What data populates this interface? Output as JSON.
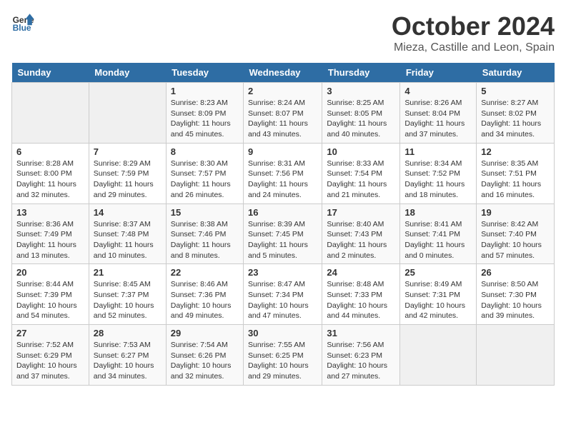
{
  "header": {
    "logo_line1": "General",
    "logo_line2": "Blue",
    "month": "October 2024",
    "location": "Mieza, Castille and Leon, Spain"
  },
  "weekdays": [
    "Sunday",
    "Monday",
    "Tuesday",
    "Wednesday",
    "Thursday",
    "Friday",
    "Saturday"
  ],
  "weeks": [
    [
      {
        "day": "",
        "info": ""
      },
      {
        "day": "",
        "info": ""
      },
      {
        "day": "1",
        "info": "Sunrise: 8:23 AM\nSunset: 8:09 PM\nDaylight: 11 hours and 45 minutes."
      },
      {
        "day": "2",
        "info": "Sunrise: 8:24 AM\nSunset: 8:07 PM\nDaylight: 11 hours and 43 minutes."
      },
      {
        "day": "3",
        "info": "Sunrise: 8:25 AM\nSunset: 8:05 PM\nDaylight: 11 hours and 40 minutes."
      },
      {
        "day": "4",
        "info": "Sunrise: 8:26 AM\nSunset: 8:04 PM\nDaylight: 11 hours and 37 minutes."
      },
      {
        "day": "5",
        "info": "Sunrise: 8:27 AM\nSunset: 8:02 PM\nDaylight: 11 hours and 34 minutes."
      }
    ],
    [
      {
        "day": "6",
        "info": "Sunrise: 8:28 AM\nSunset: 8:00 PM\nDaylight: 11 hours and 32 minutes."
      },
      {
        "day": "7",
        "info": "Sunrise: 8:29 AM\nSunset: 7:59 PM\nDaylight: 11 hours and 29 minutes."
      },
      {
        "day": "8",
        "info": "Sunrise: 8:30 AM\nSunset: 7:57 PM\nDaylight: 11 hours and 26 minutes."
      },
      {
        "day": "9",
        "info": "Sunrise: 8:31 AM\nSunset: 7:56 PM\nDaylight: 11 hours and 24 minutes."
      },
      {
        "day": "10",
        "info": "Sunrise: 8:33 AM\nSunset: 7:54 PM\nDaylight: 11 hours and 21 minutes."
      },
      {
        "day": "11",
        "info": "Sunrise: 8:34 AM\nSunset: 7:52 PM\nDaylight: 11 hours and 18 minutes."
      },
      {
        "day": "12",
        "info": "Sunrise: 8:35 AM\nSunset: 7:51 PM\nDaylight: 11 hours and 16 minutes."
      }
    ],
    [
      {
        "day": "13",
        "info": "Sunrise: 8:36 AM\nSunset: 7:49 PM\nDaylight: 11 hours and 13 minutes."
      },
      {
        "day": "14",
        "info": "Sunrise: 8:37 AM\nSunset: 7:48 PM\nDaylight: 11 hours and 10 minutes."
      },
      {
        "day": "15",
        "info": "Sunrise: 8:38 AM\nSunset: 7:46 PM\nDaylight: 11 hours and 8 minutes."
      },
      {
        "day": "16",
        "info": "Sunrise: 8:39 AM\nSunset: 7:45 PM\nDaylight: 11 hours and 5 minutes."
      },
      {
        "day": "17",
        "info": "Sunrise: 8:40 AM\nSunset: 7:43 PM\nDaylight: 11 hours and 2 minutes."
      },
      {
        "day": "18",
        "info": "Sunrise: 8:41 AM\nSunset: 7:41 PM\nDaylight: 11 hours and 0 minutes."
      },
      {
        "day": "19",
        "info": "Sunrise: 8:42 AM\nSunset: 7:40 PM\nDaylight: 10 hours and 57 minutes."
      }
    ],
    [
      {
        "day": "20",
        "info": "Sunrise: 8:44 AM\nSunset: 7:39 PM\nDaylight: 10 hours and 54 minutes."
      },
      {
        "day": "21",
        "info": "Sunrise: 8:45 AM\nSunset: 7:37 PM\nDaylight: 10 hours and 52 minutes."
      },
      {
        "day": "22",
        "info": "Sunrise: 8:46 AM\nSunset: 7:36 PM\nDaylight: 10 hours and 49 minutes."
      },
      {
        "day": "23",
        "info": "Sunrise: 8:47 AM\nSunset: 7:34 PM\nDaylight: 10 hours and 47 minutes."
      },
      {
        "day": "24",
        "info": "Sunrise: 8:48 AM\nSunset: 7:33 PM\nDaylight: 10 hours and 44 minutes."
      },
      {
        "day": "25",
        "info": "Sunrise: 8:49 AM\nSunset: 7:31 PM\nDaylight: 10 hours and 42 minutes."
      },
      {
        "day": "26",
        "info": "Sunrise: 8:50 AM\nSunset: 7:30 PM\nDaylight: 10 hours and 39 minutes."
      }
    ],
    [
      {
        "day": "27",
        "info": "Sunrise: 7:52 AM\nSunset: 6:29 PM\nDaylight: 10 hours and 37 minutes."
      },
      {
        "day": "28",
        "info": "Sunrise: 7:53 AM\nSunset: 6:27 PM\nDaylight: 10 hours and 34 minutes."
      },
      {
        "day": "29",
        "info": "Sunrise: 7:54 AM\nSunset: 6:26 PM\nDaylight: 10 hours and 32 minutes."
      },
      {
        "day": "30",
        "info": "Sunrise: 7:55 AM\nSunset: 6:25 PM\nDaylight: 10 hours and 29 minutes."
      },
      {
        "day": "31",
        "info": "Sunrise: 7:56 AM\nSunset: 6:23 PM\nDaylight: 10 hours and 27 minutes."
      },
      {
        "day": "",
        "info": ""
      },
      {
        "day": "",
        "info": ""
      }
    ]
  ]
}
